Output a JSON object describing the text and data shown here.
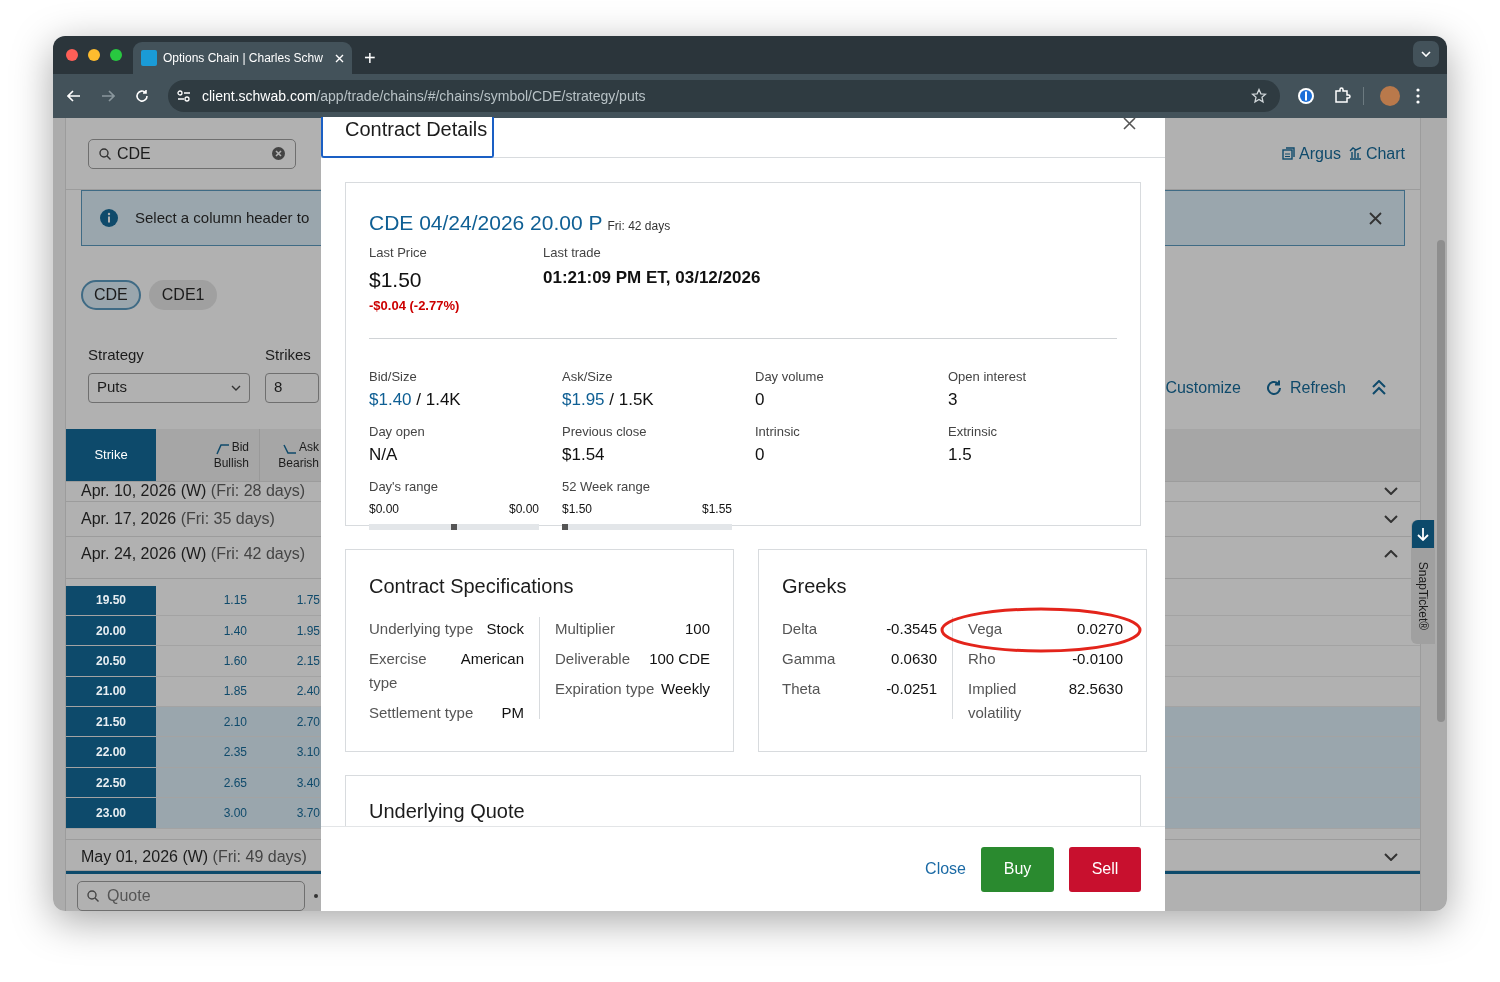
{
  "browser": {
    "tab_title": "Options Chain | Charles Schw",
    "new_tab": "+",
    "url": {
      "host": "client.schwab.com",
      "path": "/app/trade/chains/#/chains/symbol/CDE/strategy/puts"
    }
  },
  "app": {
    "search": {
      "value": "CDE"
    },
    "links": [
      {
        "label": "Argus",
        "kind": "report"
      },
      {
        "label": "Chart",
        "kind": "chart"
      }
    ],
    "banner": {
      "text": "Select a column header to"
    },
    "symbols": [
      {
        "label": "CDE",
        "selected": true
      },
      {
        "label": "CDE1",
        "selected": false
      }
    ],
    "strategy": {
      "label": "Strategy",
      "value": "Puts"
    },
    "strikes": {
      "label": "Strikes",
      "value": "8"
    },
    "actions": [
      {
        "label": "Customize",
        "kind": "customize"
      },
      {
        "label": "Refresh",
        "kind": "refresh"
      },
      {
        "kind": "collapse"
      }
    ],
    "columns": [
      {
        "label": "Strike"
      },
      {
        "label": "Bid",
        "sub": "Bullish",
        "kind": "bid"
      },
      {
        "label": "Ask",
        "sub": "Bearish",
        "kind": "ask"
      }
    ],
    "expirations": [
      {
        "date": "Apr. 10, 2026 (W)",
        "days": "(Fri: 28 days)",
        "expanded": false
      },
      {
        "date": "Apr. 17, 2026",
        "days": "(Fri: 35 days)",
        "expanded": false
      },
      {
        "date": "Apr. 24, 2026 (W)",
        "days": "(Fri: 42 days)",
        "expanded": true,
        "rows": [
          {
            "strike": "19.50",
            "bid": "1.15",
            "ask": "1.75",
            "in_the_money": false
          },
          {
            "strike": "20.00",
            "bid": "1.40",
            "ask": "1.95",
            "in_the_money": false
          },
          {
            "strike": "20.50",
            "bid": "1.60",
            "ask": "2.15",
            "in_the_money": false
          },
          {
            "strike": "21.00",
            "bid": "1.85",
            "ask": "2.40",
            "in_the_money": false
          },
          {
            "strike": "21.50",
            "bid": "2.10",
            "ask": "2.70",
            "in_the_money": true
          },
          {
            "strike": "22.00",
            "bid": "2.35",
            "ask": "3.10",
            "in_the_money": true
          },
          {
            "strike": "22.50",
            "bid": "2.65",
            "ask": "3.40",
            "in_the_money": true
          },
          {
            "strike": "23.00",
            "bid": "3.00",
            "ask": "3.70",
            "in_the_money": true
          }
        ]
      },
      {
        "date": "May 01, 2026 (W)",
        "days": "(Fri: 49 days)",
        "expanded": false
      }
    ],
    "quote": {
      "placeholder": "Quote"
    },
    "side_tab": "SnapTicket®"
  },
  "modal": {
    "title": "Contract Details",
    "contract": {
      "symbol": "CDE 04/24/2026 20.00 P",
      "expiry_note": "Fri: 42 days",
      "last_price_label": "Last Price",
      "last_price": "$1.50",
      "change": "-$0.04 (-2.77%)",
      "last_trade_label": "Last trade",
      "last_trade": "01:21:09 PM ET, 03/12/2026"
    },
    "stats": [
      {
        "kind": "price_size",
        "label": "Bid/Size",
        "price": "$1.40",
        "size": "/ 1.4K"
      },
      {
        "kind": "price_size",
        "label": "Ask/Size",
        "price": "$1.95",
        "size": "/ 1.5K"
      },
      {
        "kind": "plain",
        "label": "Day volume",
        "value": "0"
      },
      {
        "kind": "plain",
        "label": "Open interest",
        "value": "3"
      },
      {
        "kind": "plain",
        "label": "Day open",
        "value": "N/A"
      },
      {
        "kind": "plain",
        "label": "Previous close",
        "value": "$1.54"
      },
      {
        "kind": "plain",
        "label": "Intrinsic",
        "value": "0"
      },
      {
        "kind": "plain",
        "label": "Extrinsic",
        "value": "1.5"
      },
      {
        "kind": "range",
        "label": "Day's range",
        "low": "$0.00",
        "high": "$0.00",
        "level": 0.5
      },
      {
        "kind": "range",
        "label": "52 Week range",
        "low": "$1.50",
        "high": "$1.55",
        "level": 0
      }
    ],
    "specs": {
      "title": "Contract Specifications",
      "left": [
        {
          "label": "Underlying type",
          "value": "Stock"
        },
        {
          "label": "Exercise type",
          "value": "American"
        },
        {
          "label": "Settlement type",
          "value": "PM"
        }
      ],
      "right": [
        {
          "label": "Multiplier",
          "value": "100"
        },
        {
          "label": "Deliverable",
          "value": "100 CDE"
        },
        {
          "label": "Expiration type",
          "value": "Weekly"
        }
      ]
    },
    "greeks": {
      "title": "Greeks",
      "left": [
        {
          "label": "Delta",
          "value": "-0.3545"
        },
        {
          "label": "Gamma",
          "value": "0.0630"
        },
        {
          "label": "Theta",
          "value": "-0.0251"
        }
      ],
      "right": [
        {
          "label": "Vega",
          "value": "0.0270"
        },
        {
          "label": "Rho",
          "value": "-0.0100"
        },
        {
          "label": "Implied volatility",
          "value": "82.5630"
        }
      ]
    },
    "underlying": {
      "title": "Underlying Quote"
    },
    "footer": {
      "close": "Close",
      "buy": "Buy",
      "sell": "Sell"
    }
  }
}
